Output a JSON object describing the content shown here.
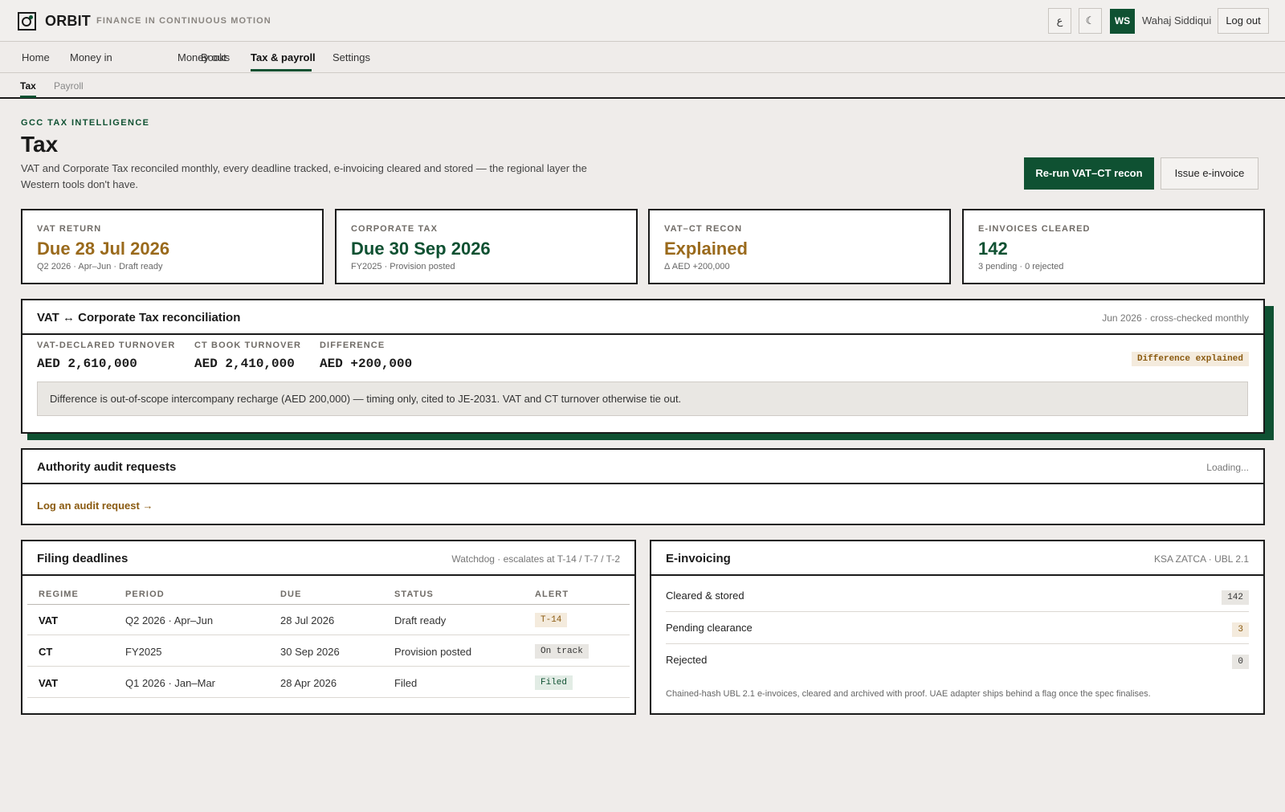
{
  "app": {
    "brand": "ORBIT",
    "tagline": "FINANCE IN CONTINUOUS MOTION"
  },
  "header": {
    "lang_button": "ع",
    "theme_button": "☾",
    "avatar_initials": "WS",
    "user_name": "Wahaj Siddiqui",
    "logout_label": "Log out"
  },
  "main_nav": [
    "Home",
    "Money in",
    "Money out",
    "Books",
    "Tax & payroll",
    "Settings"
  ],
  "main_nav_active": "Tax & payroll",
  "sub_nav": [
    "Tax",
    "Payroll"
  ],
  "sub_nav_active": "Tax",
  "page": {
    "eyebrow": "GCC TAX INTELLIGENCE",
    "title": "Tax",
    "description": "VAT and Corporate Tax reconciled monthly, every deadline tracked, e-invoicing cleared and stored — the regional layer the Western tools don't have.",
    "primary_action": "Re-run VAT–CT recon",
    "secondary_action": "Issue e-invoice"
  },
  "cards": [
    {
      "label": "VAT RETURN",
      "value": "Due 28 Jul 2026",
      "sub": "Q2 2026 · Apr–Jun · Draft ready",
      "tone": "amber"
    },
    {
      "label": "CORPORATE TAX",
      "value": "Due 30 Sep 2026",
      "sub": "FY2025 · Provision posted",
      "tone": "green"
    },
    {
      "label": "VAT–CT RECON",
      "value": "Explained",
      "sub": "Δ AED +200,000",
      "tone": "amber"
    },
    {
      "label": "E-INVOICES CLEARED",
      "value": "142",
      "sub": "3 pending · 0 rejected",
      "tone": "green"
    }
  ],
  "recon": {
    "title": "VAT ↔ Corporate Tax reconciliation",
    "meta": "Jun 2026 · cross-checked monthly",
    "vat_label": "VAT-DECLARED TURNOVER",
    "vat_value": "AED 2,610,000",
    "ct_label": "CT BOOK TURNOVER",
    "ct_value": "AED 2,410,000",
    "diff_label": "DIFFERENCE",
    "diff_value": "AED +200,000",
    "badge": "Difference explained",
    "note": "Difference is out-of-scope intercompany recharge (AED 200,000) — timing only, cited to JE-2031. VAT and CT turnover otherwise tie out."
  },
  "audit": {
    "title": "Authority audit requests",
    "status": "Loading...",
    "link": "Log an audit request →"
  },
  "deadlines": {
    "title": "Filing deadlines",
    "meta": "Watchdog · escalates at T-14 / T-7 / T-2",
    "columns": [
      "REGIME",
      "PERIOD",
      "DUE",
      "STATUS",
      "ALERT"
    ],
    "rows": [
      {
        "regime": "VAT",
        "period": "Q2 2026 · Apr–Jun",
        "due": "28 Jul 2026",
        "status": "Draft ready",
        "alert": "T-14",
        "alert_tone": "amber"
      },
      {
        "regime": "CT",
        "period": "FY2025",
        "due": "30 Sep 2026",
        "status": "Provision posted",
        "alert": "On track",
        "alert_tone": "gray"
      },
      {
        "regime": "VAT",
        "period": "Q1 2026 · Jan–Mar",
        "due": "28 Apr 2026",
        "status": "Filed",
        "alert": "Filed",
        "alert_tone": "green"
      }
    ]
  },
  "einvoicing": {
    "title": "E-invoicing",
    "meta": "KSA ZATCA · UBL 2.1",
    "rows": [
      {
        "label": "Cleared & stored",
        "count": "142",
        "tone": "gray"
      },
      {
        "label": "Pending clearance",
        "count": "3",
        "tone": "amber"
      },
      {
        "label": "Rejected",
        "count": "0",
        "tone": "gray"
      }
    ],
    "footnote": "Chained-hash UBL 2.1 e-invoices, cleared and archived with proof. UAE adapter ships behind a flag once the spec finalises."
  },
  "colors": {
    "brand_green": "#0f5132",
    "amber": "#9a6a1c",
    "background": "#efecea"
  }
}
